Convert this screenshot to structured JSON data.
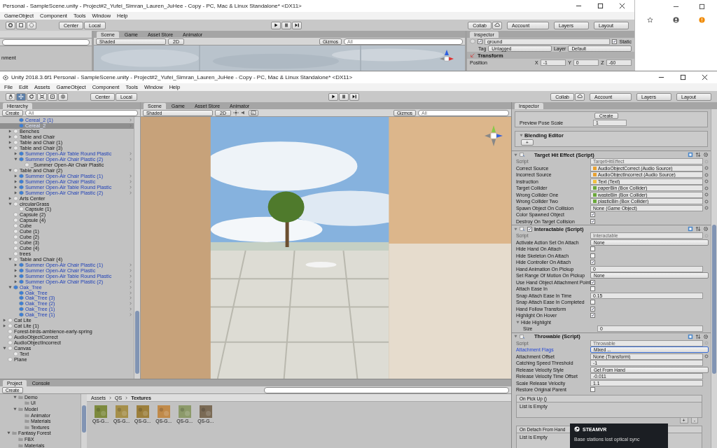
{
  "back_window": {
    "title": "Personal - SampleScene.unity - Project#2_Yufei_Simran_Lauren_JuHee - Copy - PC, Mac & Linux Standalone* <DX11>",
    "menu": [
      "GameObject",
      "Component",
      "Tools",
      "Window",
      "Help"
    ],
    "toolbar": {
      "pivot": "Center",
      "space": "Local",
      "collab": "Collab",
      "account": "Account",
      "layers": "Layers",
      "layout": "Layout"
    },
    "hierarchy_fragment": "nment",
    "scene_tabs": [
      {
        "label": "Scene",
        "selected": true
      },
      {
        "label": "Game",
        "selected": false
      },
      {
        "label": "Asset Store",
        "selected": false
      },
      {
        "label": "Animator",
        "selected": false
      }
    ],
    "scene_toolbar": {
      "shading": "Shaded",
      "mode_2d": "2D",
      "gizmos": "Gizmos",
      "search_placeholder": "All"
    },
    "inspector": {
      "tab": "Inspector",
      "name": "ground",
      "active": true,
      "static": true,
      "static_label": "Static",
      "tag_label": "Tag",
      "tag": "Untagged",
      "layer_label": "Layer",
      "layer": "Default",
      "component": "Transform",
      "position_label": "Position",
      "position": [
        {
          "axis": "X",
          "value": "-1"
        },
        {
          "axis": "Y",
          "value": "0"
        },
        {
          "axis": "Z",
          "value": "-60"
        }
      ]
    }
  },
  "front_window": {
    "title": "Unity 2018.3.6f1 Personal - SampleScene.unity - Project#2_Yufei_Simran_Lauren_JuHee - Copy - PC, Mac & Linux Standalone* <DX11>",
    "menu": [
      "File",
      "Edit",
      "Assets",
      "GameObject",
      "Component",
      "Tools",
      "Window",
      "Help"
    ],
    "toolbar": {
      "pivot": "Center",
      "space": "Local",
      "collab": "Collab",
      "account": "Account",
      "layers": "Layers",
      "layout": "Layout"
    },
    "hierarchy": {
      "tab": "Hierarchy",
      "create": "Create",
      "search_placeholder": "All",
      "items": [
        {
          "children": [
            {
              "children": [
                {
                  "label": "Cereal_2 (1)",
                  "prefab": true,
                  "selected": false
                },
                {
                  "label": "Cereal_2",
                  "prefab": true,
                  "selected": true
                }
              ]
            },
            {
              "label": "Benches",
              "prefab": false,
              "selected": false,
              "expanded": false
            },
            {
              "label": "Table and Chair",
              "prefab": false,
              "selected": false,
              "expanded": false
            },
            {
              "label": "Table and Chair (1)",
              "prefab": false,
              "selected": false,
              "expanded": false
            },
            {
              "label": "Table and Chair (3)",
              "prefab": false,
              "selected": false,
              "expanded": true,
              "children": [
                {
                  "label": "Summer Open-Air Table Round Plastic",
                  "prefab": true,
                  "selected": false,
                  "expanded": false
                },
                {
                  "label": "Summer Open-Air Chair Plastic (2)",
                  "prefab": true,
                  "selected": false,
                  "expanded": true,
                  "children": [
                    {
                      "label": "_Summer Open-Air Chair Plastic",
                      "prefab": false,
                      "selected": false
                    }
                  ]
                }
              ]
            },
            {
              "label": "Table and Chair (2)",
              "prefab": false,
              "selected": false,
              "expanded": true,
              "children": [
                {
                  "label": "Summer Open-Air Chair Plastic (1)",
                  "prefab": true,
                  "selected": false,
                  "expanded": false
                },
                {
                  "label": "Summer Open-Air Chair Plastic",
                  "prefab": true,
                  "selected": false,
                  "expanded": false
                },
                {
                  "label": "Summer Open-Air Table Round Plastic",
                  "prefab": true,
                  "selected": false,
                  "expanded": false
                },
                {
                  "label": "Summer Open-Air Chair Plastic (2)",
                  "prefab": true,
                  "selected": false,
                  "expanded": false
                }
              ]
            },
            {
              "label": "Arts Center",
              "prefab": false,
              "selected": false,
              "expanded": false
            },
            {
              "label": "circularGrass",
              "prefab": false,
              "selected": false,
              "expanded": true,
              "children": [
                {
                  "label": "Capsule (1)",
                  "prefab": false,
                  "selected": false
                }
              ]
            },
            {
              "label": "Capsule (2)",
              "prefab": false,
              "selected": false
            },
            {
              "label": "Capsule (4)",
              "prefab": false,
              "selected": false
            },
            {
              "label": "Cube",
              "prefab": false,
              "selected": false
            },
            {
              "label": "Cube (1)",
              "prefab": false,
              "selected": false
            },
            {
              "label": "Cube (2)",
              "prefab": false,
              "selected": false
            },
            {
              "label": "Cube (3)",
              "prefab": false,
              "selected": false
            },
            {
              "label": "Cube (4)",
              "prefab": false,
              "selected": false
            },
            {
              "label": "trees",
              "prefab": false,
              "selected": false
            },
            {
              "label": "Table and Chair (4)",
              "prefab": false,
              "selected": false,
              "expanded": true,
              "children": [
                {
                  "label": "Summer Open-Air Chair Plastic (1)",
                  "prefab": true,
                  "selected": false,
                  "expanded": false
                },
                {
                  "label": "Summer Open-Air Chair Plastic",
                  "prefab": true,
                  "selected": false,
                  "expanded": false
                },
                {
                  "label": "Summer Open-Air Table Round Plastic",
                  "prefab": true,
                  "selected": false,
                  "expanded": false
                },
                {
                  "label": "Summer Open-Air Chair Plastic (2)",
                  "prefab": true,
                  "selected": false,
                  "expanded": false
                }
              ]
            },
            {
              "label": "Oak_Tree",
              "prefab": true,
              "selected": false,
              "expanded": true,
              "children": [
                {
                  "label": "Oak_Tree",
                  "prefab": true,
                  "selected": false
                },
                {
                  "label": "Oak_Tree (3)",
                  "prefab": true,
                  "selected": false
                },
                {
                  "label": "Oak_Tree (2)",
                  "prefab": true,
                  "selected": false
                },
                {
                  "label": "Oak_Tree (1)",
                  "prefab": true,
                  "selected": false
                },
                {
                  "label": "Oak_Tree (1)",
                  "prefab": true,
                  "selected": false
                }
              ]
            }
          ]
        },
        {
          "label": "Cat Lite",
          "prefab": false,
          "selected": false,
          "expanded": false
        },
        {
          "label": "Cat Lite (1)",
          "prefab": false,
          "selected": false,
          "expanded": false
        },
        {
          "label": "Forest-birds-ambience-early-spring",
          "prefab": false,
          "selected": false
        },
        {
          "label": "AudioObjectCorrect",
          "prefab": false,
          "selected": false
        },
        {
          "label": "AudioObjectIncorrect",
          "prefab": false,
          "selected": false
        },
        {
          "label": "Canvas",
          "prefab": false,
          "selected": false,
          "expanded": true,
          "children": [
            {
              "label": "Text",
              "prefab": false,
              "selected": false
            }
          ]
        },
        {
          "label": "Plane",
          "prefab": false,
          "selected": false
        }
      ]
    },
    "scene": {
      "tabs": [
        {
          "label": "Scene",
          "selected": true
        },
        {
          "label": "Game",
          "selected": false
        },
        {
          "label": "Asset Store",
          "selected": false
        },
        {
          "label": "Animator",
          "selected": false
        }
      ],
      "shading": "Shaded",
      "mode_2d": "2D",
      "gizmos": "Gizmos",
      "search_placeholder": "All"
    },
    "project": {
      "tabs": [
        {
          "label": "Project",
          "selected": true
        },
        {
          "label": "Console",
          "selected": false
        }
      ],
      "create": "Create",
      "tree": [
        {
          "children": [
            {
              "label": "Demo",
              "expanded": true,
              "children": [
                {
                  "label": "UI"
                }
              ]
            },
            {
              "label": "Model",
              "expanded": true,
              "children": [
                {
                  "label": "Animator"
                },
                {
                  "label": "Materials"
                },
                {
                  "label": "Textures"
                }
              ]
            }
          ]
        },
        {
          "label": "Fantasy Forest",
          "expanded": true,
          "children": [
            {
              "label": "FBX"
            },
            {
              "label": "Materials"
            }
          ]
        }
      ],
      "breadcrumb": [
        "Assets",
        "QS",
        "Textures"
      ],
      "assets": [
        {
          "label": "QS-G...",
          "color": "#7d8a3e"
        },
        {
          "label": "QS-G...",
          "color": "#a58f4a"
        },
        {
          "label": "QS-G...",
          "color": "#9c7f3c"
        },
        {
          "label": "QS-G...",
          "color": "#c08a4a"
        },
        {
          "label": "QS-G...",
          "color": "#8c9a6a"
        },
        {
          "label": "QS-G...",
          "color": "#7a6a55"
        }
      ]
    },
    "inspector": {
      "tab": "Inspector",
      "top_box": {
        "button": "Create",
        "label": "Preview Pose Scale",
        "value": "1"
      },
      "blending_editor": {
        "title": "Blending Editor",
        "expanded": true,
        "button": "+"
      },
      "components": [
        {
          "title": "Target Hit Effect (Script)",
          "expanded": true,
          "fields": [
            {
              "kind": "script",
              "label": "Script",
              "value": "TargetHitEffect"
            },
            {
              "kind": "object",
              "label": "Correct Source",
              "value": "AudioObjectCorrect (Audio Source)",
              "color": "#e8a030"
            },
            {
              "kind": "object",
              "label": "Incorrect Source",
              "value": "AudioObjectIncorrect (Audio Source)",
              "color": "#e8a030"
            },
            {
              "kind": "object",
              "label": "Instruction",
              "value": "Text (Text)",
              "color": "#f0c040"
            },
            {
              "kind": "object",
              "label": "Target Collider",
              "value": "paperBin (Box Collider)",
              "color": "#6aa83a"
            },
            {
              "kind": "object",
              "label": "Wrong Collider One",
              "value": "wasteBin (Box Collider)",
              "color": "#6aa83a"
            },
            {
              "kind": "object",
              "label": "Wrong Collider Two",
              "value": "plasticBin (Box Collider)",
              "color": "#6aa83a"
            },
            {
              "kind": "object",
              "label": "Spawn Object On Collision",
              "value": "None (Game Object)"
            },
            {
              "kind": "check",
              "label": "Color Spawned Object",
              "checked": true
            },
            {
              "kind": "check",
              "label": "Destroy On Target Collision",
              "checked": true
            }
          ]
        },
        {
          "title": "Interactable (Script)",
          "expanded": true,
          "enabled": true,
          "fields": [
            {
              "kind": "script",
              "label": "Script",
              "value": "Interactable"
            },
            {
              "kind": "enum",
              "label": "Activate Action Set On Attach",
              "value": "None",
              "focused": false
            },
            {
              "kind": "check",
              "label": "Hide Hand On Attach",
              "checked": false
            },
            {
              "kind": "check",
              "label": "Hide Skeleton On Attach",
              "checked": false
            },
            {
              "kind": "check",
              "label": "Hide Controller On Attach",
              "checked": true
            },
            {
              "kind": "text",
              "label": "Hand Animation On Pickup",
              "value": "0"
            },
            {
              "kind": "enum",
              "label": "Set Range Of Motion On Pickup",
              "value": "None",
              "focused": false
            },
            {
              "kind": "check",
              "label": "Use Hand Object Attachment Point",
              "checked": true
            },
            {
              "kind": "check",
              "label": "Attach Ease In",
              "checked": false
            },
            {
              "kind": "text",
              "label": "Snap Attach Ease In Time",
              "value": "0.15"
            },
            {
              "kind": "check",
              "label": "Snap Attach Ease In Completed",
              "checked": false
            },
            {
              "kind": "check",
              "label": "Hand Follow Transform",
              "checked": true
            },
            {
              "kind": "check",
              "label": "Highlight On Hover",
              "checked": true
            },
            {
              "kind": "foldout",
              "label": "Hide Highlight",
              "expanded": true,
              "children": [
                {
                  "kind": "text",
                  "label": "Size",
                  "value": "0"
                }
              ]
            }
          ]
        },
        {
          "title": "Throwable (Script)",
          "expanded": true,
          "fields": [
            {
              "kind": "script",
              "label": "Script",
              "value": "Throwable"
            },
            {
              "kind": "enum",
              "label": "Attachment Flags",
              "value": "Mixed ...",
              "focused": true
            },
            {
              "kind": "object",
              "label": "Attachment Offset",
              "value": "None (Transform)"
            },
            {
              "kind": "text",
              "label": "Catching Speed Threshold",
              "value": "-1"
            },
            {
              "kind": "enum",
              "label": "Release Velocity Style",
              "value": "Get From Hand",
              "focused": false
            },
            {
              "kind": "text",
              "label": "Release Velocity Time Offset",
              "value": "-0.011"
            },
            {
              "kind": "text",
              "label": "Scale Release Velocity",
              "value": "1.1"
            },
            {
              "kind": "check",
              "label": "Restore Original Parent",
              "checked": false
            }
          ],
          "events": [
            {
              "title": "On Pick Up ()",
              "body": "List is Empty",
              "buttons": [
                "+",
                "-"
              ]
            },
            {
              "title": "On Detach From Hand",
              "body": "List is Empty"
            }
          ]
        }
      ]
    }
  },
  "notification": {
    "brand": "STEAMVR",
    "message": "Base stations lost optical sync"
  }
}
